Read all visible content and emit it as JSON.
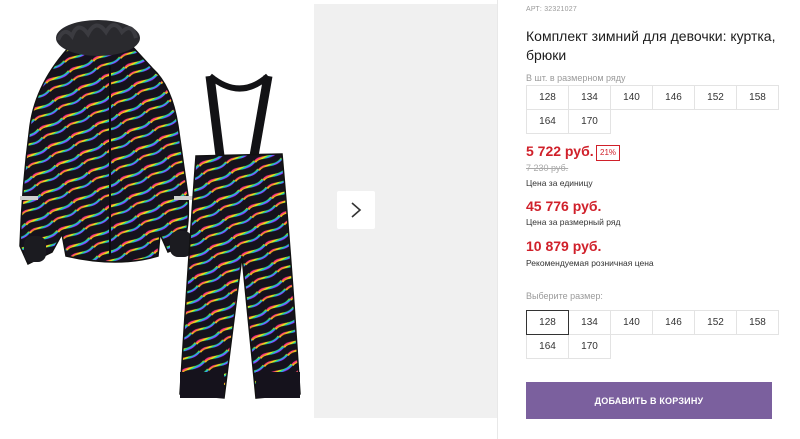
{
  "product": {
    "sku": "АРТ: 32321027",
    "title": "Комплект зимний для девочки: куртка, брюки"
  },
  "row_sizes": {
    "label": "В шт. в размерном ряду",
    "items": [
      "128",
      "134",
      "140",
      "146",
      "152",
      "158",
      "164",
      "170"
    ]
  },
  "pricing": {
    "unit_price": "5 722 руб.",
    "discount": "21%",
    "old_price": "7 230 руб.",
    "unit_caption": "Цена за единицу",
    "row_price": "45 776 руб.",
    "row_caption": "Цена за размерный ряд",
    "retail_price": "10 879 руб.",
    "retail_caption": "Рекомендуемая розничная цена",
    "accent_color": "#d0202a"
  },
  "size_select": {
    "label": "Выберите размер:",
    "items": [
      "128",
      "134",
      "140",
      "146",
      "152",
      "158",
      "164",
      "170"
    ],
    "selected": "128"
  },
  "cart": {
    "add_label": "ДОБАВИТЬ В КОРЗИНУ",
    "button_color": "#7b609e"
  },
  "gallery": {
    "next_icon": "chevron-right-icon"
  }
}
